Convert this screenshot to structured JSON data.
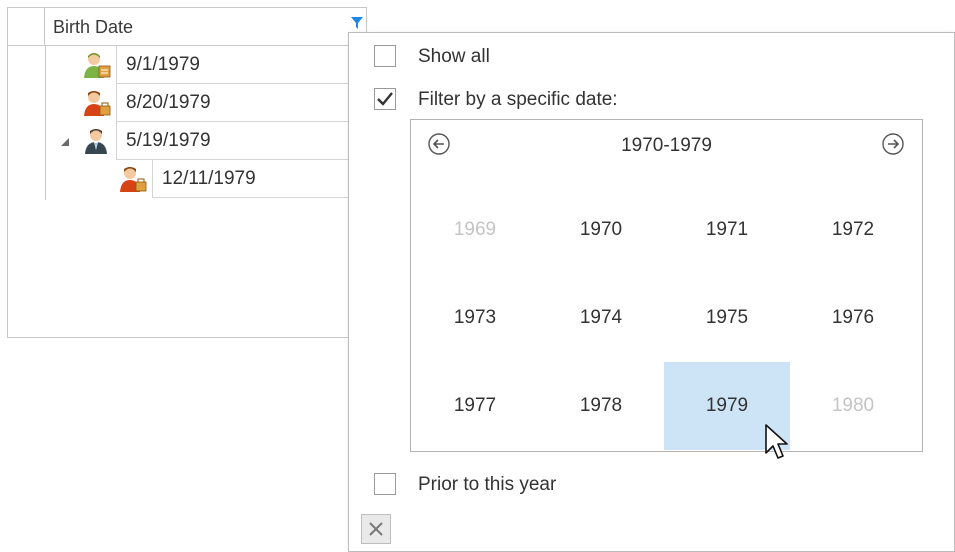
{
  "grid": {
    "header_title": "Birth Date",
    "rows": [
      {
        "date": "9/1/1979",
        "icon": "female-user-icon"
      },
      {
        "date": "8/20/1979",
        "icon": "male-user-icon"
      },
      {
        "date": "5/19/1979",
        "icon": "manager-user-icon",
        "expanded": true
      },
      {
        "date": "12/11/1979",
        "icon": "male-user-icon"
      }
    ]
  },
  "filter_popup": {
    "show_all_label": "Show all",
    "show_all_checked": false,
    "specific_date_label": "Filter by a specific date:",
    "specific_date_checked": true,
    "prior_label": "Prior to this year",
    "prior_checked": false,
    "calendar": {
      "title": "1970-1979",
      "years": [
        {
          "label": "1969",
          "dim": true
        },
        {
          "label": "1970"
        },
        {
          "label": "1971"
        },
        {
          "label": "1972"
        },
        {
          "label": "1973"
        },
        {
          "label": "1974"
        },
        {
          "label": "1975"
        },
        {
          "label": "1976"
        },
        {
          "label": "1977"
        },
        {
          "label": "1978"
        },
        {
          "label": "1979",
          "selected": true
        },
        {
          "label": "1980",
          "dim": true
        }
      ]
    }
  },
  "colors": {
    "selection": "#cde4f6",
    "border": "#c8c8c8",
    "filter_icon": "#1e88e5"
  }
}
